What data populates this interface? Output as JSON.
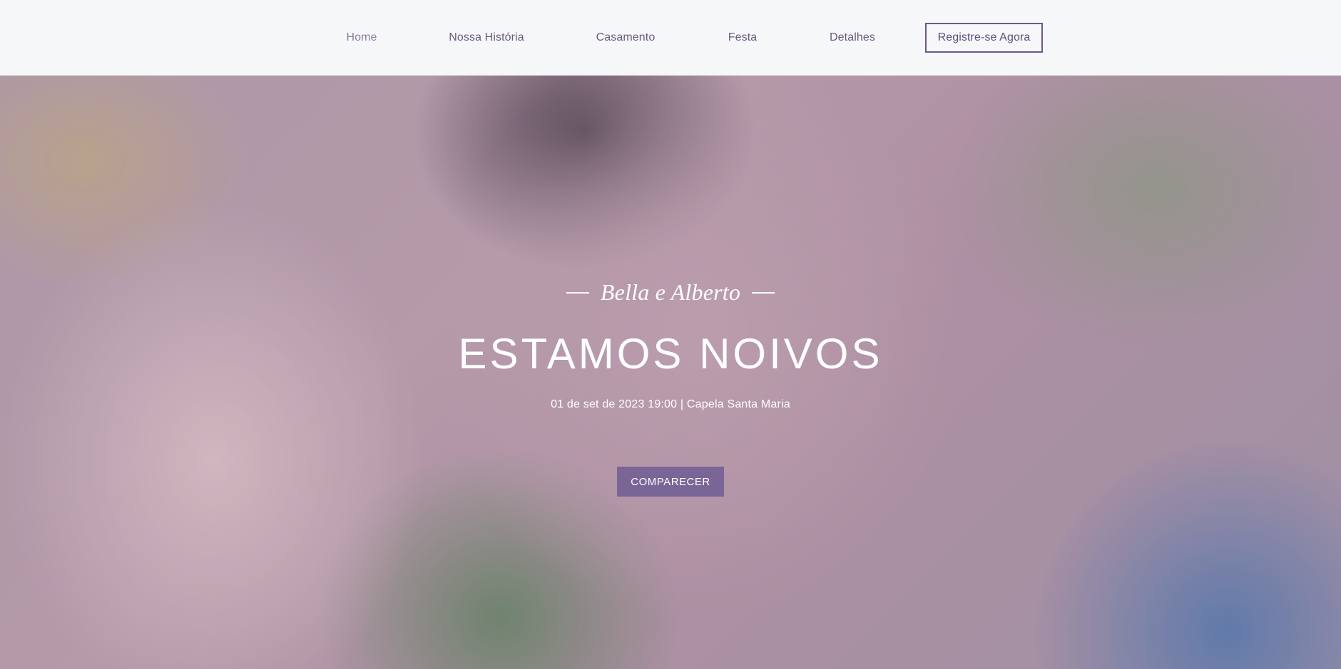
{
  "nav": {
    "items": [
      {
        "label": "Home"
      },
      {
        "label": "Nossa História"
      },
      {
        "label": "Casamento"
      },
      {
        "label": "Festa"
      },
      {
        "label": "Detalhes"
      }
    ],
    "register_label": "Registre-se Agora"
  },
  "hero": {
    "names": "Bella e Alberto",
    "headline": "ESTAMOS NOIVOS",
    "subline": "01 de set de 2023 19:00 | Capela Santa Maria",
    "cta_label": "COMPARECER"
  },
  "colors": {
    "accent": "#7a6597",
    "nav_text": "#6b5a7e",
    "header_bg": "#f6f7f9"
  }
}
